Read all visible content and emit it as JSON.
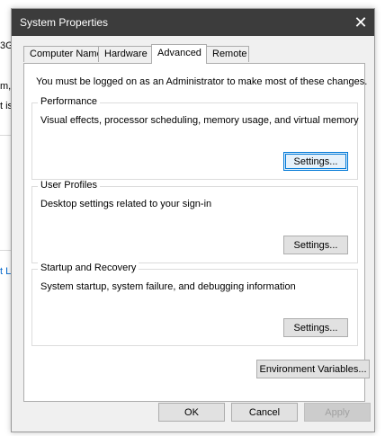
{
  "background": {
    "fragment_1": "3G",
    "fragment_2": "m,",
    "fragment_3": "t is",
    "link_fragment": "t Li"
  },
  "window": {
    "title": "System Properties",
    "close_glyph": "✕"
  },
  "tabs": [
    {
      "label": "Computer Name",
      "active": false
    },
    {
      "label": "Hardware",
      "active": false
    },
    {
      "label": "Advanced",
      "active": true
    },
    {
      "label": "Remote",
      "active": false
    }
  ],
  "panel": {
    "notice": "You must be logged on as an Administrator to make most of these changes.",
    "performance": {
      "title": "Performance",
      "description": "Visual effects, processor scheduling, memory usage, and virtual memory",
      "button": "Settings..."
    },
    "user_profiles": {
      "title": "User Profiles",
      "description": "Desktop settings related to your sign-in",
      "button": "Settings..."
    },
    "startup_recovery": {
      "title": "Startup and Recovery",
      "description": "System startup, system failure, and debugging information",
      "button": "Settings..."
    },
    "env_button": "Environment Variables..."
  },
  "footer": {
    "ok": "OK",
    "cancel": "Cancel",
    "apply": "Apply"
  },
  "colors": {
    "titlebar": "#3c3c3c",
    "focus_accent": "#0078d7",
    "background_link": "#0066cc"
  }
}
